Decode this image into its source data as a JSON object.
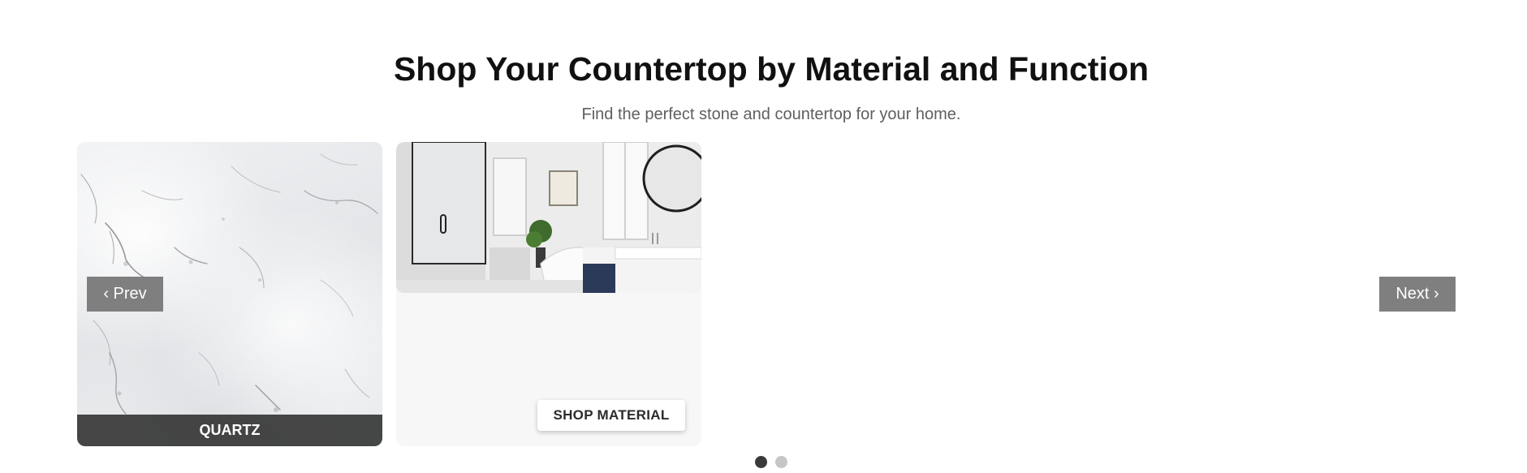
{
  "header": {
    "title": "Shop Your Countertop by Material and Function",
    "subtitle": "Find the perfect stone and countertop for your home."
  },
  "carousel": {
    "prev_label": "‹ Prev",
    "next_label": "Next ›",
    "cards": [
      {
        "label": "QUARTZ",
        "image": "quartz-marble-texture"
      },
      {
        "image": "white-bathroom-interior",
        "button_label": "SHOP MATERIAL"
      }
    ],
    "pagination": {
      "total": 2,
      "active": 1
    }
  },
  "colors": {
    "nav_button_bg": "#7f7f7f",
    "label_bar_bg": "#282828",
    "dot_active": "#3a3a3a",
    "dot_inactive": "#c6c6c6"
  }
}
